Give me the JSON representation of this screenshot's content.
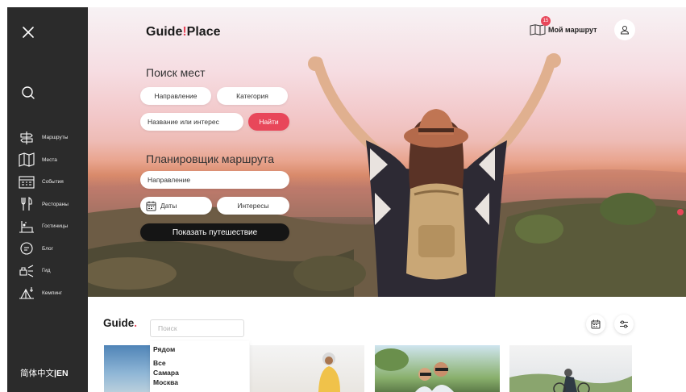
{
  "sidebar": {
    "items": [
      {
        "label": "Маршруты",
        "icon": "signpost-icon"
      },
      {
        "label": "Места",
        "icon": "map-icon"
      },
      {
        "label": "События",
        "icon": "calendar-icon"
      },
      {
        "label": "Рестораны",
        "icon": "cutlery-icon"
      },
      {
        "label": "Гостиницы",
        "icon": "hotel-bell-icon"
      },
      {
        "label": "Блог",
        "icon": "chat-icon"
      },
      {
        "label": "Гид",
        "icon": "guide-icon"
      },
      {
        "label": "Кемпинг",
        "icon": "camping-icon"
      }
    ],
    "lang_cn": "简体中文",
    "lang_sep": "|",
    "lang_en": "EN"
  },
  "header": {
    "logo_left": "Guide",
    "logo_right": "Place",
    "route_label": "Мой маршрут",
    "route_badge": "15"
  },
  "search_places": {
    "title": "Поиск мест",
    "direction": "Направление",
    "category": "Категория",
    "name_or_interest": "Название или интерес",
    "find": "Найти"
  },
  "planner": {
    "title": "Планировщик маршрута",
    "direction": "Направление",
    "dates": "Даты",
    "interests": "Интересы",
    "show": "Показать путешествие"
  },
  "lower": {
    "brand": "Guide",
    "brand_dot": ".",
    "search_placeholder": "Поиск",
    "dropdown": [
      "Рядом",
      "Все",
      "Самара",
      "Москва"
    ]
  },
  "colors": {
    "accent": "#e8475a",
    "sidebar": "#2b2b2b"
  }
}
